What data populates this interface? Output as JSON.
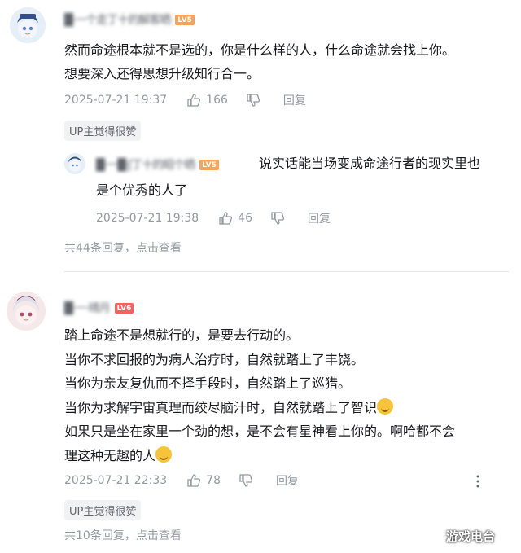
{
  "comments": [
    {
      "username": "█·一个走丁十的解客晒",
      "level": "LV5",
      "level_color": "#f6a35b",
      "lines": [
        "然而命途根本就不是选的，你是什么样的人，什么命途就会找上你。",
        "想要深入还得思想升级知行合一。"
      ],
      "time": "2025-07-21 19:37",
      "likes": "166",
      "reply_label": "回复",
      "tag": "UP主觉得很赞",
      "reply": {
        "username": "█·一█·ʃ丁十的昭个晒",
        "level": "LV5",
        "level_color": "#f6a35b",
        "lines": [
          "说实话能当场变成命途行者的现实里也",
          "是个优秀的人了"
        ],
        "time": "2025-07-21 19:38",
        "likes": "46",
        "reply_label": "回复"
      },
      "more_replies": "共44条回复，点击查看"
    },
    {
      "username": "█·一·晴月",
      "level": "LV6",
      "level_color": "#f36262",
      "lines": [
        "踏上命途不是想就行的，是要去行动的。",
        "当你不求回报的为病人治疗时，自然就踏上了丰饶。",
        "当你为亲友复仇而不择手段时，自然踏上了巡猎。",
        "当你为求解宇宙真理而绞尽脑汁时，自然就踏上了智识",
        "如果只是坐在家里一个劲的想，是不会有星神看上你的。啊哈都不会",
        "理这种无趣的人"
      ],
      "time": "2025-07-21 22:33",
      "likes": "78",
      "reply_label": "回复",
      "tag": "UP主觉得很赞",
      "more_replies": "共10条回复，点击查看"
    }
  ],
  "icons": {
    "like": "thumbs-up-icon",
    "dislike": "thumbs-down-icon",
    "more": "more-dots-icon"
  },
  "watermark": "游戏电台"
}
